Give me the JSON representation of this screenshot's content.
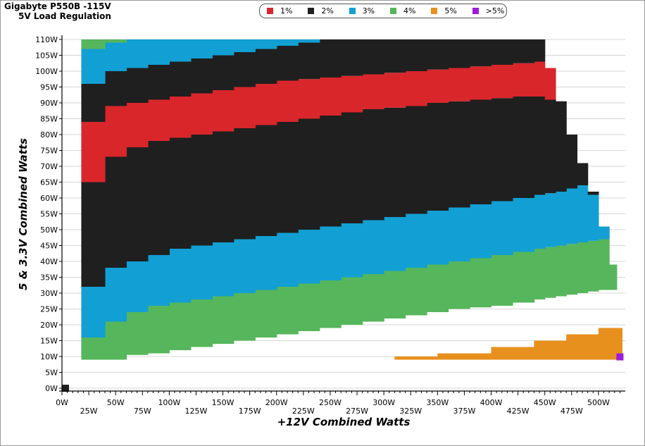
{
  "header": {
    "title": "Gigabyte P550B -115V",
    "subtitle": "5V Load Regulation"
  },
  "chart_data": {
    "type": "area",
    "title": "Gigabyte P550B -115V",
    "subtitle": "5V Load Regulation",
    "xlabel": "+12V Combined Watts",
    "ylabel": "5 & 3.3V Combined Watts",
    "xlim": [
      0,
      525
    ],
    "ylim": [
      0,
      110
    ],
    "grid": true,
    "legend_position": "top",
    "x_ticks": [
      "0W",
      "25W",
      "50W",
      "75W",
      "100W",
      "125W",
      "150W",
      "175W",
      "200W",
      "225W",
      "250W",
      "275W",
      "300W",
      "325W",
      "350W",
      "375W",
      "400W",
      "425W",
      "450W",
      "475W",
      "500W"
    ],
    "y_ticks": [
      "0W",
      "5W",
      "10W",
      "15W",
      "20W",
      "25W",
      "30W",
      "35W",
      "40W",
      "45W",
      "50W",
      "55W",
      "60W",
      "65W",
      "70W",
      "75W",
      "80W",
      "85W",
      "90W",
      "95W",
      "100W",
      "105W",
      "110W"
    ],
    "legend": [
      {
        "label": "1%",
        "color": "#d9262b"
      },
      {
        "label": "2%",
        "color": "#1f1f1f"
      },
      {
        "label": "3%",
        "color": "#129fd3"
      },
      {
        "label": "4%",
        "color": "#56b65b"
      },
      {
        "label": "5%",
        "color": "#e8901e"
      },
      {
        "label": ">5%",
        "color": "#9b1bdb"
      }
    ],
    "x": [
      18,
      40,
      60,
      80,
      100,
      120,
      140,
      160,
      180,
      200,
      220,
      240,
      260,
      280,
      300,
      320,
      340,
      360,
      380,
      400,
      420,
      440,
      450,
      460,
      470,
      480,
      490,
      500,
      510,
      517
    ],
    "top_y": [
      110,
      110,
      110,
      110,
      110,
      110,
      110,
      110,
      110,
      110,
      110,
      110,
      110,
      110,
      110,
      110,
      110,
      110,
      110,
      110,
      110,
      110,
      101,
      90.5,
      80,
      71,
      62,
      51,
      39,
      31
    ],
    "bands": [
      {
        "level": "4%",
        "lower": [
          9,
          9,
          10.5,
          11,
          12,
          13,
          14,
          15,
          16,
          17,
          18,
          19,
          20,
          21,
          22,
          23,
          24,
          25,
          25.5,
          26,
          27,
          28,
          28.5,
          29,
          29.5,
          30,
          30.5,
          31,
          31,
          31
        ]
      },
      {
        "level": "3%",
        "lower": [
          16,
          21,
          24,
          26,
          27,
          28,
          29,
          30,
          31,
          32,
          33,
          34,
          35,
          36,
          37,
          38,
          39,
          40,
          41,
          42,
          43,
          44,
          44.5,
          45,
          45.5,
          46,
          46.5,
          47,
          39,
          null
        ]
      },
      {
        "level": "2%",
        "lower": [
          32,
          38,
          40,
          42,
          44,
          45,
          46,
          47,
          48,
          49,
          50,
          51,
          52,
          53,
          54,
          55,
          56,
          57,
          58,
          59,
          60,
          61,
          61.5,
          62,
          63,
          64,
          61,
          51,
          null,
          null
        ]
      },
      {
        "level": "1%",
        "lower": [
          65,
          73,
          76,
          78,
          79,
          80,
          81,
          82,
          83,
          84,
          85,
          86,
          87,
          88,
          88.5,
          89,
          90,
          90.5,
          91,
          91.5,
          92,
          92,
          91,
          90.5,
          80,
          71,
          null,
          null,
          null,
          null
        ]
      },
      {
        "level": "2%",
        "lower": [
          84,
          89,
          90,
          91,
          92,
          93,
          94,
          95,
          96,
          97,
          97.5,
          98,
          98.5,
          99,
          99.5,
          100,
          100.5,
          101,
          101.5,
          102,
          102.5,
          103,
          null,
          null,
          null,
          null,
          null,
          null,
          null,
          null
        ]
      },
      {
        "level": "3%",
        "lower": [
          96,
          100,
          101,
          102,
          103,
          104,
          105,
          106,
          107,
          108,
          109,
          110,
          110,
          110,
          110,
          110,
          110,
          110,
          110,
          110,
          110,
          110,
          null,
          null,
          null,
          null,
          null,
          null,
          null,
          null
        ]
      },
      {
        "level": "4%",
        "lower": [
          107,
          109,
          110,
          110,
          110,
          110,
          110,
          110,
          110,
          110,
          110,
          110,
          110,
          110,
          110,
          110,
          110,
          110,
          110,
          110,
          110,
          110,
          null,
          null,
          null,
          null,
          null,
          null,
          null,
          null
        ]
      }
    ],
    "orange_region": {
      "x": [
        310,
        350,
        400,
        440,
        470,
        500,
        517
      ],
      "upper": [
        10,
        11,
        13,
        15,
        17,
        19,
        19
      ]
    },
    "purple_point": {
      "x": 520,
      "y": 10
    },
    "origin_point": {
      "x": 0,
      "y": 0
    }
  }
}
